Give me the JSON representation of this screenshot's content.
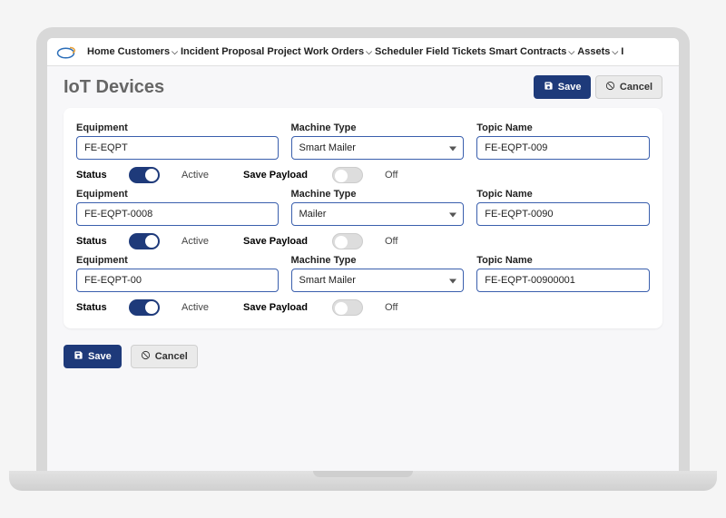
{
  "nav": {
    "items": [
      {
        "label": "Home",
        "dropdown": false
      },
      {
        "label": "Customers",
        "dropdown": true
      },
      {
        "label": "Incident",
        "dropdown": false
      },
      {
        "label": "Proposal",
        "dropdown": false
      },
      {
        "label": "Project",
        "dropdown": false
      },
      {
        "label": "Work Orders",
        "dropdown": true
      },
      {
        "label": "Scheduler",
        "dropdown": false
      },
      {
        "label": "Field Tickets",
        "dropdown": false
      },
      {
        "label": "Smart Contracts",
        "dropdown": true
      },
      {
        "label": "Assets",
        "dropdown": true
      },
      {
        "label": "I",
        "dropdown": false
      }
    ]
  },
  "page": {
    "title": "IoT Devices",
    "save_label": "Save",
    "cancel_label": "Cancel"
  },
  "labels": {
    "equipment": "Equipment",
    "machine_type": "Machine Type",
    "topic_name": "Topic Name",
    "status": "Status",
    "save_payload": "Save Payload",
    "active": "Active",
    "off": "Off"
  },
  "devices": [
    {
      "equipment": "FE-EQPT",
      "machine_type": "Smart Mailer",
      "topic_name": "FE-EQPT-009",
      "status_on": true,
      "status_text": "Active",
      "payload_on": false,
      "payload_text": "Off"
    },
    {
      "equipment": "FE-EQPT-0008",
      "machine_type": "Mailer",
      "topic_name": "FE-EQPT-0090",
      "status_on": true,
      "status_text": "Active",
      "payload_on": false,
      "payload_text": "Off"
    },
    {
      "equipment": "FE-EQPT-00",
      "machine_type": "Smart Mailer",
      "topic_name": "FE-EQPT-00900001",
      "status_on": true,
      "status_text": "Active",
      "payload_on": false,
      "payload_text": "Off"
    }
  ],
  "footer": {
    "save_label": "Save",
    "cancel_label": "Cancel"
  }
}
